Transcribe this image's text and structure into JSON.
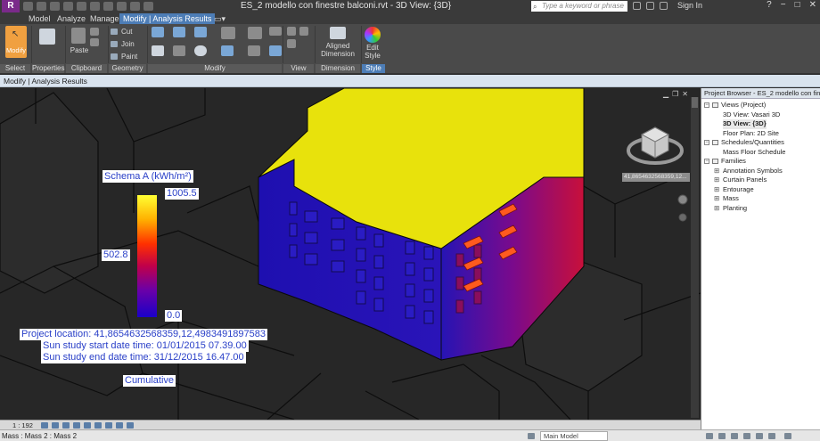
{
  "title_bar": {
    "window_title": "ES_2 modello con finestre balconi.rvt - 3D View: {3D}",
    "search_placeholder": "Type a keyword or phrase",
    "sign_in": "Sign In",
    "app_logo": "R"
  },
  "ribbon": {
    "tabs": [
      "Model",
      "Analyze",
      "Manage",
      "Modify | Analysis Results"
    ],
    "active_tab": "Modify | Analysis Results",
    "modify_label": "Modify",
    "paste_label": "Paste",
    "cut_label": "Cut",
    "join_label": "Join",
    "paint_label": "Paint",
    "aligned_dimension_label": "Aligned Dimension",
    "edit_style_label": "Edit Style",
    "panels": [
      "Select",
      "Properties",
      "Clipboard",
      "Geometry",
      "Modify",
      "View",
      "Dimension",
      "Style"
    ]
  },
  "options_bar": {
    "context": "Modify | Analysis Results"
  },
  "viewport": {
    "legend": {
      "title": "Schema A (kWh/m²)",
      "max": "1005.5",
      "mid": "502.8",
      "min": "0.0"
    },
    "info": {
      "project_location": "Project location: 41,8654632568359,12,4983491897583",
      "start_date": "Sun study start date time: 01/01/2015 07.39.00",
      "end_date": "Sun study end date time: 31/12/2015 16.47.00",
      "mode": "Cumulative"
    },
    "coord_readout": "41,8654632568359,12...",
    "colors": {
      "roof": "#e8e20c",
      "facade_low": "#1e14b4",
      "facade_high": "#c0103c",
      "balcony": "#ff5a1e"
    }
  },
  "project_browser": {
    "header": "Project Browser - ES_2 modello con fin...",
    "tree": [
      {
        "label": "Views (Project)",
        "level": 0,
        "expander": "−"
      },
      {
        "label": "3D View: Vasari 3D",
        "level": 1
      },
      {
        "label": "3D View: {3D}",
        "level": 1,
        "selected": true
      },
      {
        "label": "Floor Plan: 2D Site",
        "level": 1
      },
      {
        "label": "Schedules/Quantities",
        "level": 0,
        "expander": "−"
      },
      {
        "label": "Mass Floor Schedule",
        "level": 1
      },
      {
        "label": "Families",
        "level": 0,
        "expander": "−"
      },
      {
        "label": "Annotation Symbols",
        "level": 2
      },
      {
        "label": "Curtain Panels",
        "level": 2
      },
      {
        "label": "Entourage",
        "level": 2
      },
      {
        "label": "Mass",
        "level": 2
      },
      {
        "label": "Planting",
        "level": 2
      }
    ]
  },
  "view_control_bar": {
    "scale": "1 : 192"
  },
  "status_bar": {
    "text": "Mass : Mass 2 : Mass 2",
    "workset": "Main Model"
  }
}
